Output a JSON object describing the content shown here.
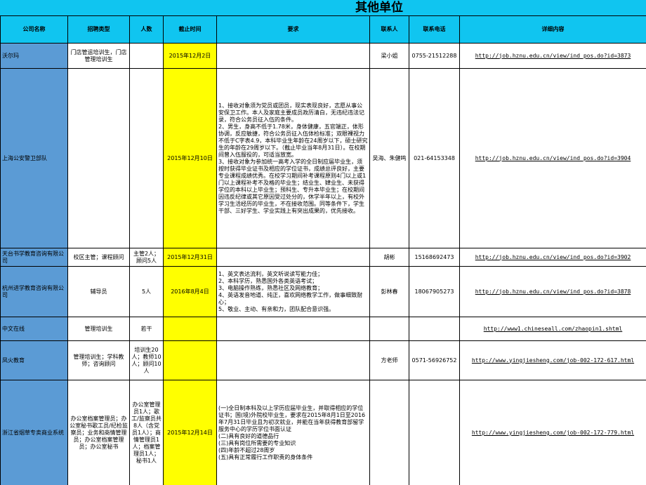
{
  "title": "其他单位",
  "headers": {
    "company": "公司名称",
    "type": "招聘类型",
    "count": "人数",
    "deadline": "截止时间",
    "requirements": "要求",
    "contact": "联系人",
    "phone": "联系电话",
    "detail": "详细内容"
  },
  "colors": {
    "header": "#10c5f0",
    "company": "#5b9bd5",
    "deadline": "#ffff00"
  },
  "rows": [
    {
      "company": "沃尔玛",
      "type": "门店管运培训生，门店管理培训生",
      "count": "",
      "deadline": "2015年12月2日",
      "requirements": [],
      "contact": "梁小姐",
      "phone": "0755-21512288",
      "detail": "http://job.hznu.edu.cn/view/ind_pos.do?id=3873"
    },
    {
      "company": "上海公安警卫部队",
      "type": "",
      "count": "",
      "deadline": "2015年12月10日",
      "requirements": [
        "1、接收对象须为党员或团员，现实表现良好，志愿从事公安保卫工作。本人及家庭主要成员政历清白，无违纪违法记录，符合公务员征入伍的条件。",
        "2、男生，身高不低于1.78米，身体健康，五官端正，体形协调，反应敏捷，符合公务员征入伍体检标准；双眼裸视力不低于C字表4.9，本科毕业生年龄在24周岁以下，硕士研究生的年龄在29周岁以下。（截止毕业当年8月31日）。在校期间曾入伍服役的，可适当放宽。",
        "3、接收对象为参加统一高考入学的全日制应届毕业生，须按时获得毕业证书及相应的学位证书，成绩总评良好，主要专业课程成绩优秀。在校学习期间补考课程原则4门以上或1门以上课程补考不及格的毕业生；结业生、肄业生、未获得学位的本科以上毕业生；预科生、专升本毕业生；在校期间因违反纪律或其它原因受过处分的，休学半年以上，有校外学习生活经历的毕业生，不在接收范围。同等条件下，学生干部、三好学生、学业实践上有突出成果的，优先接收。"
      ],
      "contact": "吴海、朱健鸣",
      "phone": "021-64153348",
      "detail": "http://job.hznu.edu.cn/view/ind_pos.do?id=3904"
    },
    {
      "company": "天台书学教育咨询有限公司",
      "type": "校区主管；课程顾问",
      "count": "主管2人；顾问5人",
      "deadline": "2015年12月31日",
      "requirements": [],
      "contact": "胡彬",
      "phone": "15168692473",
      "detail": "http://job.hznu.edu.cn/view/ind_pos.do?id=3902"
    },
    {
      "company": "杭州进学教育咨询有限公司",
      "type": "辅导员",
      "count": "5人",
      "deadline": "2016年8月4日",
      "requirements": [
        "1、英文表达流利，英文听说读写能力佳；",
        "2、本科学历，熟悉国外各类英语考试；",
        "3、电脑操作熟练，熟悉社区及网络教育；",
        "4、英语发音地道、纯正，喜欢网络教学工作，做事细致耐心；",
        "5、敬业、主动、有亲和力，团队配合意识强。"
      ],
      "contact": "彭林春",
      "phone": "18067905273",
      "detail": "http://job.hznu.edu.cn/view/ind_pos.do?id=3878"
    },
    {
      "company": "中文在线",
      "type": "管理培训生",
      "count": "若干",
      "deadline": "",
      "requirements": [],
      "contact": "",
      "phone": "",
      "detail": "http://www1.chineseall.com/zhaopin1.shtml"
    },
    {
      "company": "凤火教育",
      "type": "管理培训生；学科教师；咨询顾问",
      "count": "培训生20人；教师10人；顾问10人",
      "deadline": "",
      "requirements": [],
      "contact": "方老师",
      "phone": "0571-56926752",
      "detail": "http://www.yingjiesheng.com/job-002-172-617.html"
    },
    {
      "company": "浙江省烟草专卖商业系统",
      "type": "办公室档案管理员；办公室秘书歌工员/纪检监察员；业务和商情管理员；办公室档案管理员；办公室秘书",
      "count": "办公室管理员1人；歌工/监察员共8人（含党员1人）；商情管理员1人；档案管理员1人；秘书1人",
      "deadline": "2015年12月14日",
      "requirements": [
        "(一)全日制本科及以上学历应届毕业生，并取得相应的学位证书；国(境)外院校毕业生，要求在2015年8月1日至2016年7月31日毕业且为初次就业，并能在当年获得教育部留学服务中心的学历学位书面认证",
        "(二)具有良好的道德品行",
        "(三)具有岗位所需要的专业知识",
        "(四)年龄不超过28周岁",
        "(五)具有正常履行工作职责的身体条件"
      ],
      "contact": "",
      "phone": "",
      "detail": "http://www.yingjiesheng.com/job-002-172-779.html"
    }
  ]
}
